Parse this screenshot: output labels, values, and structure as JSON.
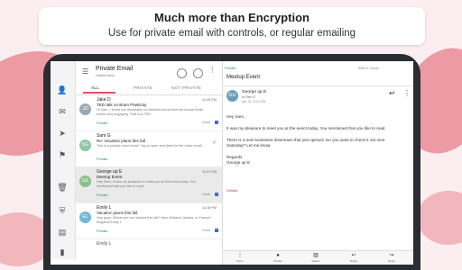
{
  "banner": {
    "title": "Much more than Encryption",
    "subtitle": "Use for private email with controls, or regular emailing"
  },
  "app": {
    "title": "Private Email",
    "subtitle": "Unified Inbox"
  },
  "tabs": [
    "ALL",
    "PRIVATE",
    "NOT PRIVATE"
  ],
  "emails": [
    {
      "initials": "JD",
      "sender": "Jake D",
      "time": "11:45 PM",
      "subject": "TED talk on Brain Plasticity",
      "snippet": "Hi Sam, I found our discussion on theories about how the human brain works very engaging. That is a TED",
      "tag": "Private",
      "source": "Gmail",
      "count": "",
      "color": "#9aa8b4"
    },
    {
      "initials": "SG",
      "sender": "Sam G",
      "time": "",
      "subject": "Re: Vacation plans this fall",
      "snippet": "This is a private voice email. Tap to open and listen to the voice email.",
      "tag": "Private",
      "source": "",
      "count": "(2",
      "color": "#8cc9a2"
    },
    {
      "initials": "GE",
      "sender": "George up E",
      "time": "11:01 PM",
      "subject": "Meetup Event",
      "snippet": "Hey Sam, It was my pleasure to meet you at the event today. You mentioned that you like to read.",
      "tag": "Private",
      "source": "Gmail",
      "count": "",
      "color": "#8bbf88"
    },
    {
      "initials": "EL",
      "sender": "Emily L",
      "time": "11:18 PM",
      "subject": "Vacation plans this fall",
      "snippet": "Hey guys, Where are we headed this fall? New Zealand, Alaska, or France? Regards Emily L",
      "tag": "Private",
      "source": "Gmail",
      "count": "",
      "color": "#6fb8d8"
    },
    {
      "initials": "",
      "sender": "Emily L",
      "time": "",
      "subject": "",
      "snippet": "",
      "tag": "",
      "source": "",
      "count": "",
      "color": "#6fb8d8"
    }
  ],
  "detail": {
    "label": "Private",
    "account": "IMBOX | Gmail",
    "subject": "Meetup Event",
    "initials": "GU",
    "sender": "George up E",
    "to": "to Sam G",
    "meta": "Apr 13, 11:01 PM",
    "body": [
      "Hey Sam,",
      "It was my pleasure to meet you at the event today. You mentioned that you like to read.",
      "There is a new bookstore downtown that just opened. Do you want to check it out next Saturday? Let me know.",
      "Regards",
      "George up E"
    ],
    "attachment": "Details"
  },
  "actionbar": [
    "Done",
    "Private",
    "Delete",
    "Reply",
    "Reply"
  ],
  "colors": {
    "accent": "#e0506a",
    "private_green": "#1a9e3a",
    "background_pink": "#ec9aa4"
  }
}
